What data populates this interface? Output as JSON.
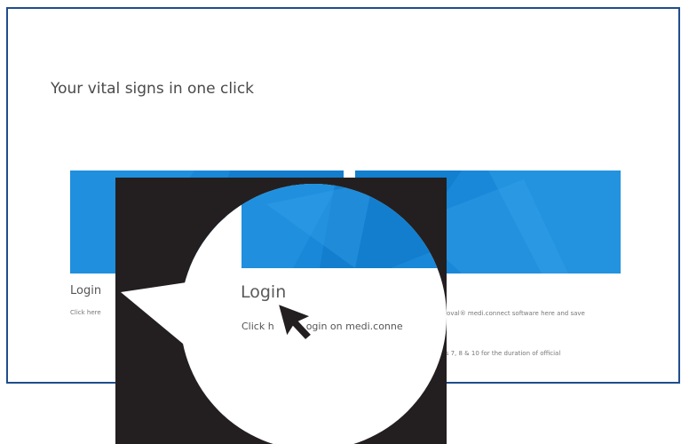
{
  "page": {
    "heading": "Your vital signs in one click"
  },
  "cards": {
    "login": {
      "title": "Login",
      "description": "Click here"
    },
    "download": {
      "description_line1": "eroval® medi.connect software here and save",
      "description_line2": "ws 7, 8 & 10 for the duration of official"
    }
  },
  "magnifier": {
    "title": "Login",
    "description_start": "Click h",
    "description_end": "ogin on medi.conne"
  },
  "colors": {
    "frame_border": "#1f4e8c",
    "banner_blue": "#1a88d8",
    "overlay_dark": "#231f20"
  },
  "icons": {
    "cursor": "arrow-cursor-icon"
  }
}
